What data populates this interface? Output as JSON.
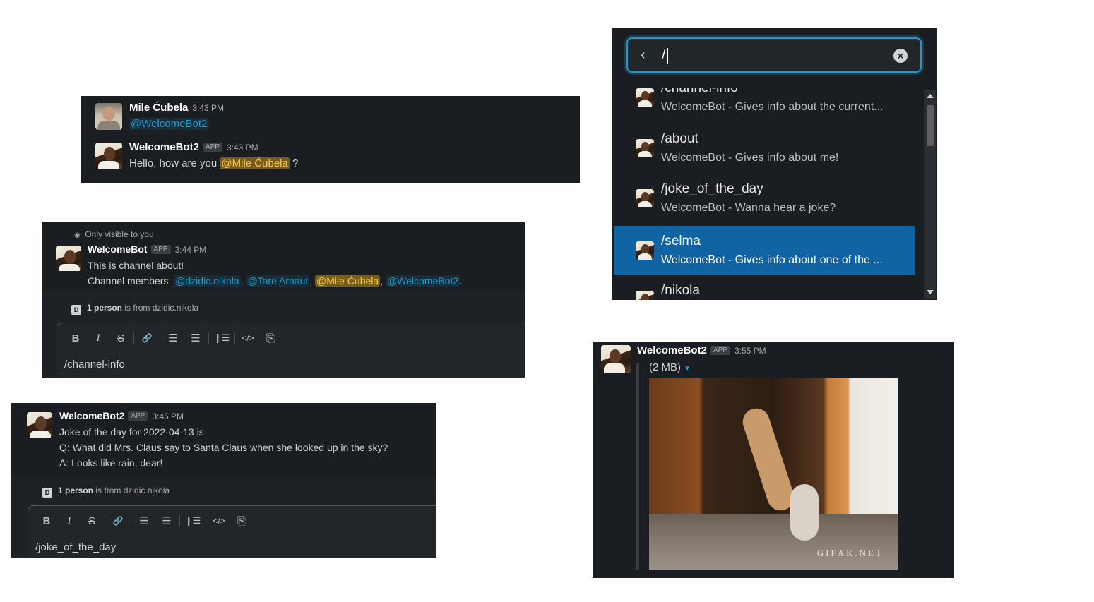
{
  "panel1": {
    "messages": [
      {
        "author": "Mile Ćubela",
        "time": "3:43 PM",
        "text": "@WelcomeBot2"
      },
      {
        "author": "WelcomeBot2",
        "badge": "APP",
        "time": "3:43 PM",
        "text_before": "Hello, how are you",
        "mention": "@Mile Ćubela",
        "text_after": "?"
      }
    ]
  },
  "panel2": {
    "visibility": "Only visible to you",
    "message": {
      "author": "WelcomeBot",
      "badge": "APP",
      "time": "3:44 PM",
      "line1": "This is channel about!",
      "members_label": "Channel members:",
      "members": [
        "@dzidic.nikola",
        "@Tare Arnaut",
        "@Mile Ćubela",
        "@WelcomeBot2"
      ]
    },
    "info": {
      "badge": "D",
      "bold": "1 person",
      "rest": "is from dzidic.nikola"
    },
    "composer_text": "/channel-info"
  },
  "panel3": {
    "message": {
      "author": "WelcomeBot2",
      "badge": "APP",
      "time": "3:45 PM",
      "lines": [
        "Joke of the day for 2022-04-13 is",
        "Q: What did Mrs. Claus say to Santa Claus when she looked up in the sky?",
        "A: Looks like rain, dear!"
      ]
    },
    "info": {
      "badge": "D",
      "bold": "1 person",
      "rest": "is from dzidic.nikola"
    },
    "composer_text": "/joke_of_the_day"
  },
  "toolbar": {
    "bold": "B",
    "italic": "I",
    "strike": "S",
    "link": "🔗",
    "ordered_list": "☰",
    "bullet_list": "☰",
    "blockquote": "❙☰",
    "code": "</>",
    "code_block": "⎘"
  },
  "autocomplete": {
    "search_value": "/",
    "items": [
      {
        "command": "/channel-info",
        "description": "WelcomeBot - Gives info about the current...",
        "selected": false
      },
      {
        "command": "/about",
        "description": "WelcomeBot - Gives info about me!",
        "selected": false
      },
      {
        "command": "/joke_of_the_day",
        "description": "WelcomeBot - Wanna hear a joke?",
        "selected": false
      },
      {
        "command": "/selma",
        "description": "WelcomeBot - Gives info about one of the ...",
        "selected": true
      },
      {
        "command": "/nikola",
        "description": "",
        "selected": false
      }
    ]
  },
  "panel5": {
    "message": {
      "author": "WelcomeBot2",
      "badge": "APP",
      "time": "3:55 PM"
    },
    "file_size": "(2 MB)",
    "watermark": "GIFAK.NET"
  },
  "colors": {
    "background": "#1a1d21",
    "mention": "#1d9bd1",
    "self_mention_bg": "#785d1d",
    "selected": "#1164a3"
  }
}
